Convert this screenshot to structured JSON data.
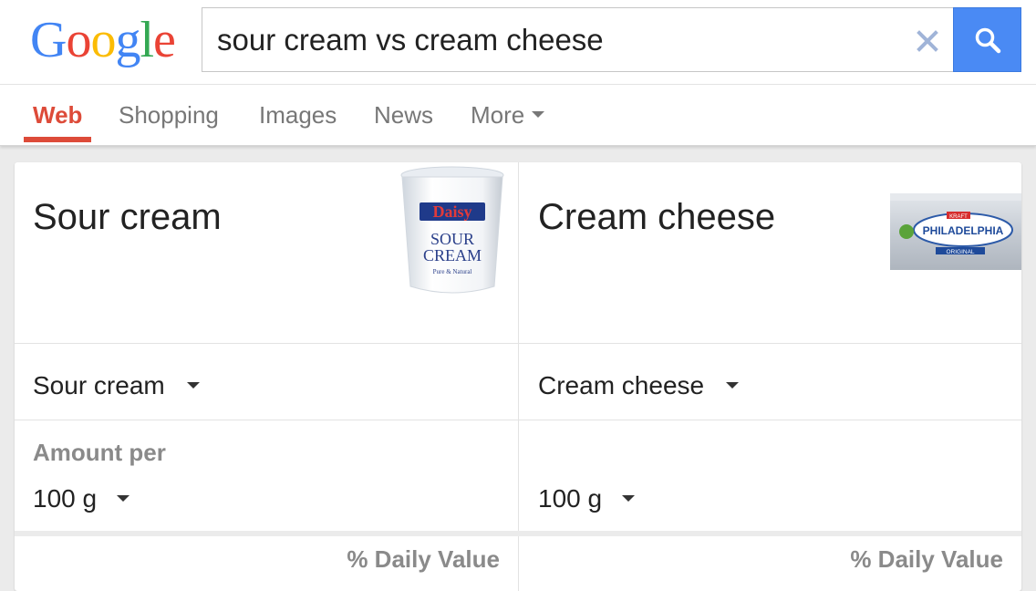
{
  "logo": {
    "letters": [
      "G",
      "o",
      "o",
      "g",
      "l",
      "e"
    ],
    "colors": [
      "#4285f4",
      "#ea4335",
      "#fbbc05",
      "#4285f4",
      "#34a853",
      "#ea4335"
    ]
  },
  "search": {
    "query": "sour cream vs cream cheese"
  },
  "tabs": [
    {
      "label": "Web",
      "active": true
    },
    {
      "label": "Shopping"
    },
    {
      "label": "Images"
    },
    {
      "label": "News"
    },
    {
      "label": "More"
    }
  ],
  "comparison": {
    "left": {
      "title": "Sour cream",
      "selected_food": "Sour cream",
      "amount": "100 g",
      "daily_value_header": "% Daily Value",
      "product": {
        "brand": "Daisy",
        "line1": "SOUR",
        "line2": "CREAM",
        "tagline": "Pure & Natural"
      }
    },
    "right": {
      "title": "Cream cheese",
      "selected_food": "Cream cheese",
      "amount": "100 g",
      "daily_value_header": "% Daily Value",
      "product": {
        "brand": "PHILADELPHIA",
        "tag": "KRAFT",
        "variant": "ORIGINAL"
      }
    },
    "amount_per_label": "Amount per"
  },
  "colors": {
    "active_tab": "#dd4b39",
    "search_button": "#4a8af4"
  }
}
